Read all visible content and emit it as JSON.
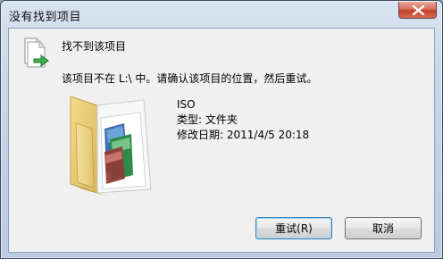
{
  "window": {
    "title": "没有找到项目"
  },
  "dialog": {
    "heading": "找不到该项目",
    "message": "该项目不在 L:\\ 中。请确认该项目的位置，然后重试。",
    "item": {
      "name": "ISO",
      "type_line": "类型: 文件夹",
      "modified_line": "修改日期: 2011/4/5 20:18"
    }
  },
  "buttons": {
    "retry_label": "重试(R)",
    "cancel_label": "取消"
  },
  "icons": {
    "title_close": "close-icon",
    "move": "file-move-icon",
    "folder": "folder-icon"
  },
  "colors": {
    "titlebar": "#c7d6e8",
    "client": "#f0f0f0",
    "close_button": "#c2412a",
    "folder": "#e9cf7b"
  }
}
